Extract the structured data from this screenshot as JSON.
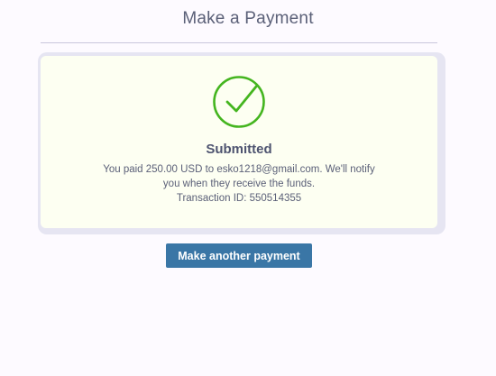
{
  "header": {
    "title": "Make a Payment"
  },
  "result": {
    "icon": "check-circle-icon",
    "status": "Submitted",
    "message_line1": "You paid 250.00 USD to esko1218@gmail.com. We'll notify",
    "message_line2": "you when they receive the funds.",
    "transaction_line": "Transaction ID: 550514355"
  },
  "actions": {
    "make_another_label": "Make another payment"
  },
  "colors": {
    "success": "#44b51f",
    "button": "#3a76a6",
    "card": "#fdfff2"
  }
}
